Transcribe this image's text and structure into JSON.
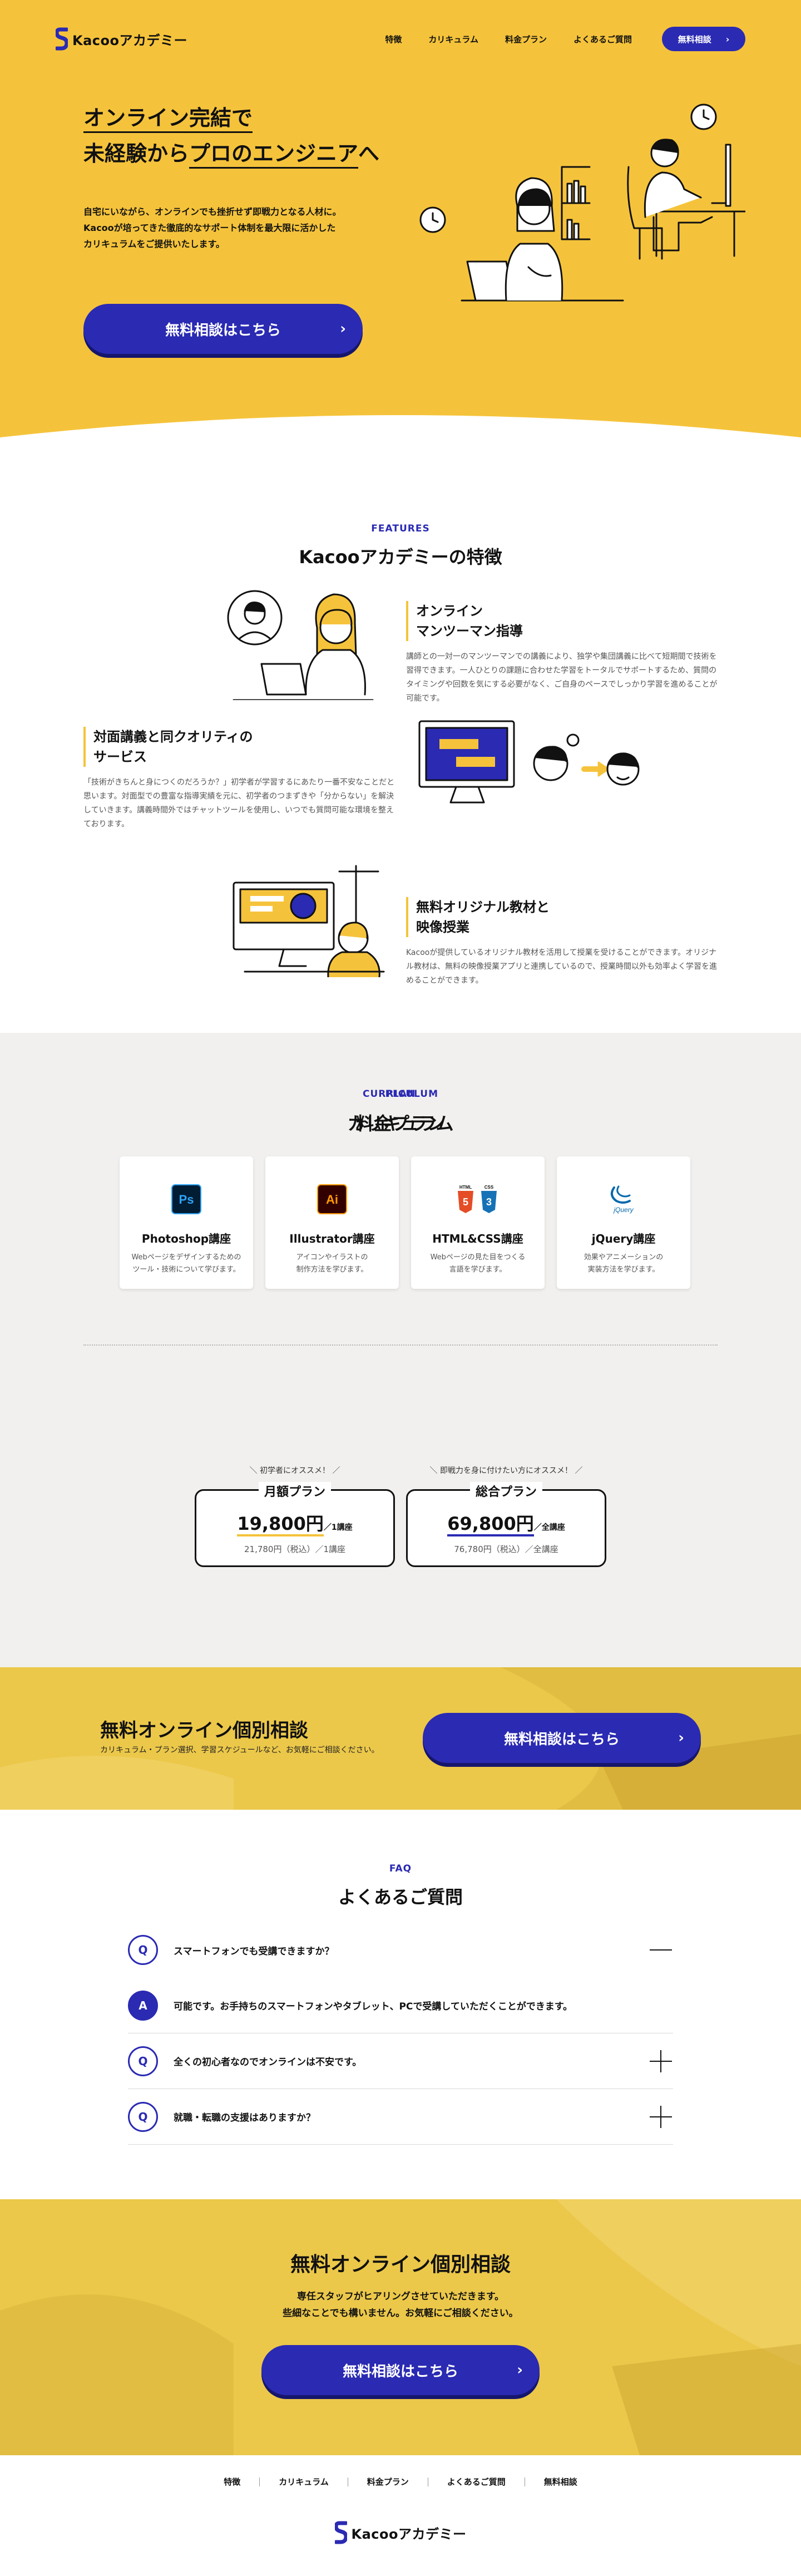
{
  "header": {
    "logo_text": "Kacooアカデミー",
    "nav": [
      "特徴",
      "カリキュラム",
      "料金プラン",
      "よくあるご質問"
    ],
    "cta_label": "無料相談"
  },
  "hero": {
    "title_line1": "オンライン完結で",
    "title_line2_pre": "未経験から",
    "title_line2_ul": "プロのエンジニア",
    "title_line2_post": "へ",
    "lead_line1": "自宅にいながら、オンラインでも挫折せず即戦力となる人材に。",
    "lead_line2": "Kacooが培ってきた徹底的なサポート体制を最大限に活かした",
    "lead_line3": "カリキュラムをご提供いたします。",
    "button_label": "無料相談はこちら"
  },
  "features": {
    "label": "FEATURES",
    "title": "Kacooアカデミーの特徴",
    "items": [
      {
        "head1": "オンライン",
        "head2": "マンツーマン指導",
        "body": "講師との一対一のマンツーマンでの講義により、独学や集団講義に比べて短期間で技術を習得できます。一人ひとりの課題に合わせた学習をトータルでサポートするため、質問のタイミングや回数を気にする必要がなく、ご自身のペースでしっかり学習を進めることが可能です。"
      },
      {
        "head1": "対面講義と同クオリティの",
        "head2": "サービス",
        "body": "「技術がきちんと身につくのだろうか？」初学者が学習するにあたり一番不安なことだと思います。対面型での豊富な指導実績を元に、初学者のつまずきや「分からない」を解決していきます。講義時間外ではチャットツールを使用し、いつでも質問可能な環境を整えております。"
      },
      {
        "head1": "無料オリジナル教材と",
        "head2": "映像授業",
        "body": "Kacooが提供しているオリジナル教材を活用して授業を受けることができます。オリジナル教材は、無料の映像授業アプリと連携しているので、授業時間以外も効率よく学習を進めることができます。"
      }
    ]
  },
  "curriculum": {
    "label": "CURRICULUM",
    "title": "カリキュラム",
    "cards": [
      {
        "title": "Photoshop講座",
        "desc1": "Webページをデザインするための",
        "desc2": "ツール・技術について学びます。",
        "icon": "Ps"
      },
      {
        "title": "Illustrator講座",
        "desc1": "アイコンやイラストの",
        "desc2": "制作方法を学びます。",
        "icon": "Ai"
      },
      {
        "title": "HTML&CSS講座",
        "desc1": "Webページの見た目をつくる",
        "desc2": "言語を学びます。",
        "icon_html": "HTML",
        "icon_css": "CSS",
        "icon_h5": "5",
        "icon_c3": "3"
      },
      {
        "title": "jQuery講座",
        "desc1": "効果やアニメーションの",
        "desc2": "実装方法を学びます。",
        "icon": "jQuery"
      }
    ]
  },
  "plan": {
    "label": "PLAN",
    "title": "料金プラン",
    "plans": [
      {
        "note": "＼ 初学者にオススメ！ ／",
        "name": "月額プラン",
        "price": "19,800円",
        "unit": "／1講座",
        "tax": "21,780円（税込）／1講座"
      },
      {
        "note": "＼ 即戦力を身に付けたい方にオススメ！ ／",
        "name": "総合プラン",
        "price": "69,800円",
        "unit": "／全講座",
        "tax": "76,780円（税込）／全講座"
      }
    ]
  },
  "cta_band": {
    "title": "無料オンライン個別相談",
    "sub": "カリキュラム・プラン選択、学習スケジュールなど、お気軽にご相談ください。",
    "button_label": "無料相談はこちら"
  },
  "faq": {
    "label": "FAQ",
    "title": "よくあるご質問",
    "items": [
      {
        "badge": "Q",
        "text": "スマートフォンでも受講できますか？"
      },
      {
        "badge": "A",
        "text": "可能です。お手持ちのスマートフォンやタブレット、PCで受講していただくことができます。"
      },
      {
        "badge": "Q",
        "text": "全くの初心者なのでオンラインは不安です。"
      },
      {
        "badge": "Q",
        "text": "就職・転職の支援はありますか？"
      }
    ]
  },
  "cta_bottom": {
    "title": "無料オンライン個別相談",
    "lead1": "専任スタッフがヒアリングさせていただきます。",
    "lead2": "些細なことでも構いません。お気軽にご相談ください。",
    "button_label": "無料相談はこちら"
  },
  "footer": {
    "nav": [
      "特徴",
      "カリキュラム",
      "料金プラン",
      "よくあるご質問",
      "無料相談"
    ],
    "logo_text": "Kacooアカデミー"
  },
  "colors": {
    "yellow": "#f5c33b",
    "navy": "#2a2ab3",
    "gray_bg": "#f2f0ee"
  }
}
